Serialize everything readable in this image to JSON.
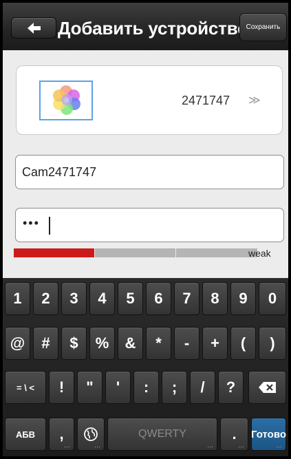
{
  "header": {
    "title": "Добавить устройство",
    "save_label": "Сохранить",
    "back_icon": "back-arrow-icon"
  },
  "device": {
    "id": "2471747",
    "chevron": "≫",
    "thumbnail_icon": "color-circles-icon"
  },
  "form": {
    "name_value": "Cam2471747",
    "password_masked": "•••",
    "strength_label": "weak",
    "strength_level_fraction": 0.33,
    "strength_color": "#cc1a1a"
  },
  "keyboard": {
    "row1": [
      "1",
      "2",
      "3",
      "4",
      "5",
      "6",
      "7",
      "8",
      "9",
      "0"
    ],
    "row2": [
      "@",
      "#",
      "$",
      "%",
      "&",
      "*",
      "-",
      "+",
      "(",
      ")"
    ],
    "row3": [
      "= \\ <",
      "!",
      "\"",
      "'",
      ":",
      ";",
      "/",
      "?"
    ],
    "backspace_icon": "backspace-icon",
    "mode_label": "АБВ",
    "comma": ",",
    "globe_icon": "globe-icon",
    "space_label": "QWERTY",
    "period": ".",
    "done_label": "Готово",
    "done_color": "#1c5584"
  }
}
